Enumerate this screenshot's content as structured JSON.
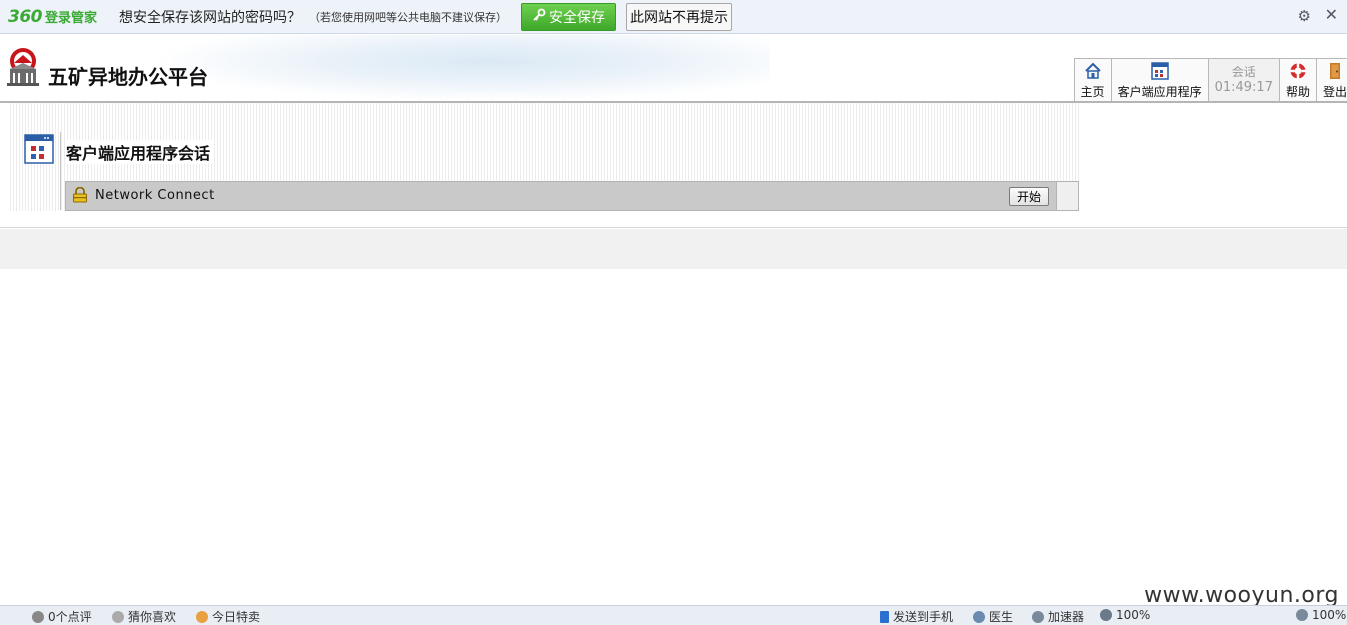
{
  "password_bar": {
    "brand_logo": "360",
    "brand_sub": "登录管家",
    "question": "想安全保存该网站的密码吗？",
    "note": "（若您使用网吧等公共电脑不建议保存）",
    "save_label": "安全保存",
    "never_label": "此网站不再提示",
    "settings_icon": "gear-icon",
    "close_icon": "close-icon"
  },
  "header": {
    "site_title": "五矿异地办公平台",
    "nav": [
      {
        "label": "主页",
        "icon": "home-icon"
      },
      {
        "label": "客户端应用程序",
        "icon": "app-window-icon"
      },
      {
        "label": "会话",
        "value": "01:49:17"
      },
      {
        "label": "帮助",
        "icon": "lifebuoy-icon"
      },
      {
        "label": "登出",
        "icon": "door-icon"
      }
    ]
  },
  "content": {
    "section_title": "客户端应用程序会话",
    "apps": [
      {
        "name": "Network Connect",
        "action": "开始",
        "icon": "lock-icon"
      }
    ]
  },
  "watermark": "www.wooyun.org",
  "statusbar": {
    "items": [
      "0个点评",
      "猜你喜欢",
      "今日特卖",
      "发送到手机",
      "医生",
      "加速器",
      "100%",
      "100%"
    ]
  },
  "colors": {
    "accent_green": "#3aaa35",
    "nav_border": "#b8b8b8",
    "row_gray": "#c9c9c9"
  }
}
